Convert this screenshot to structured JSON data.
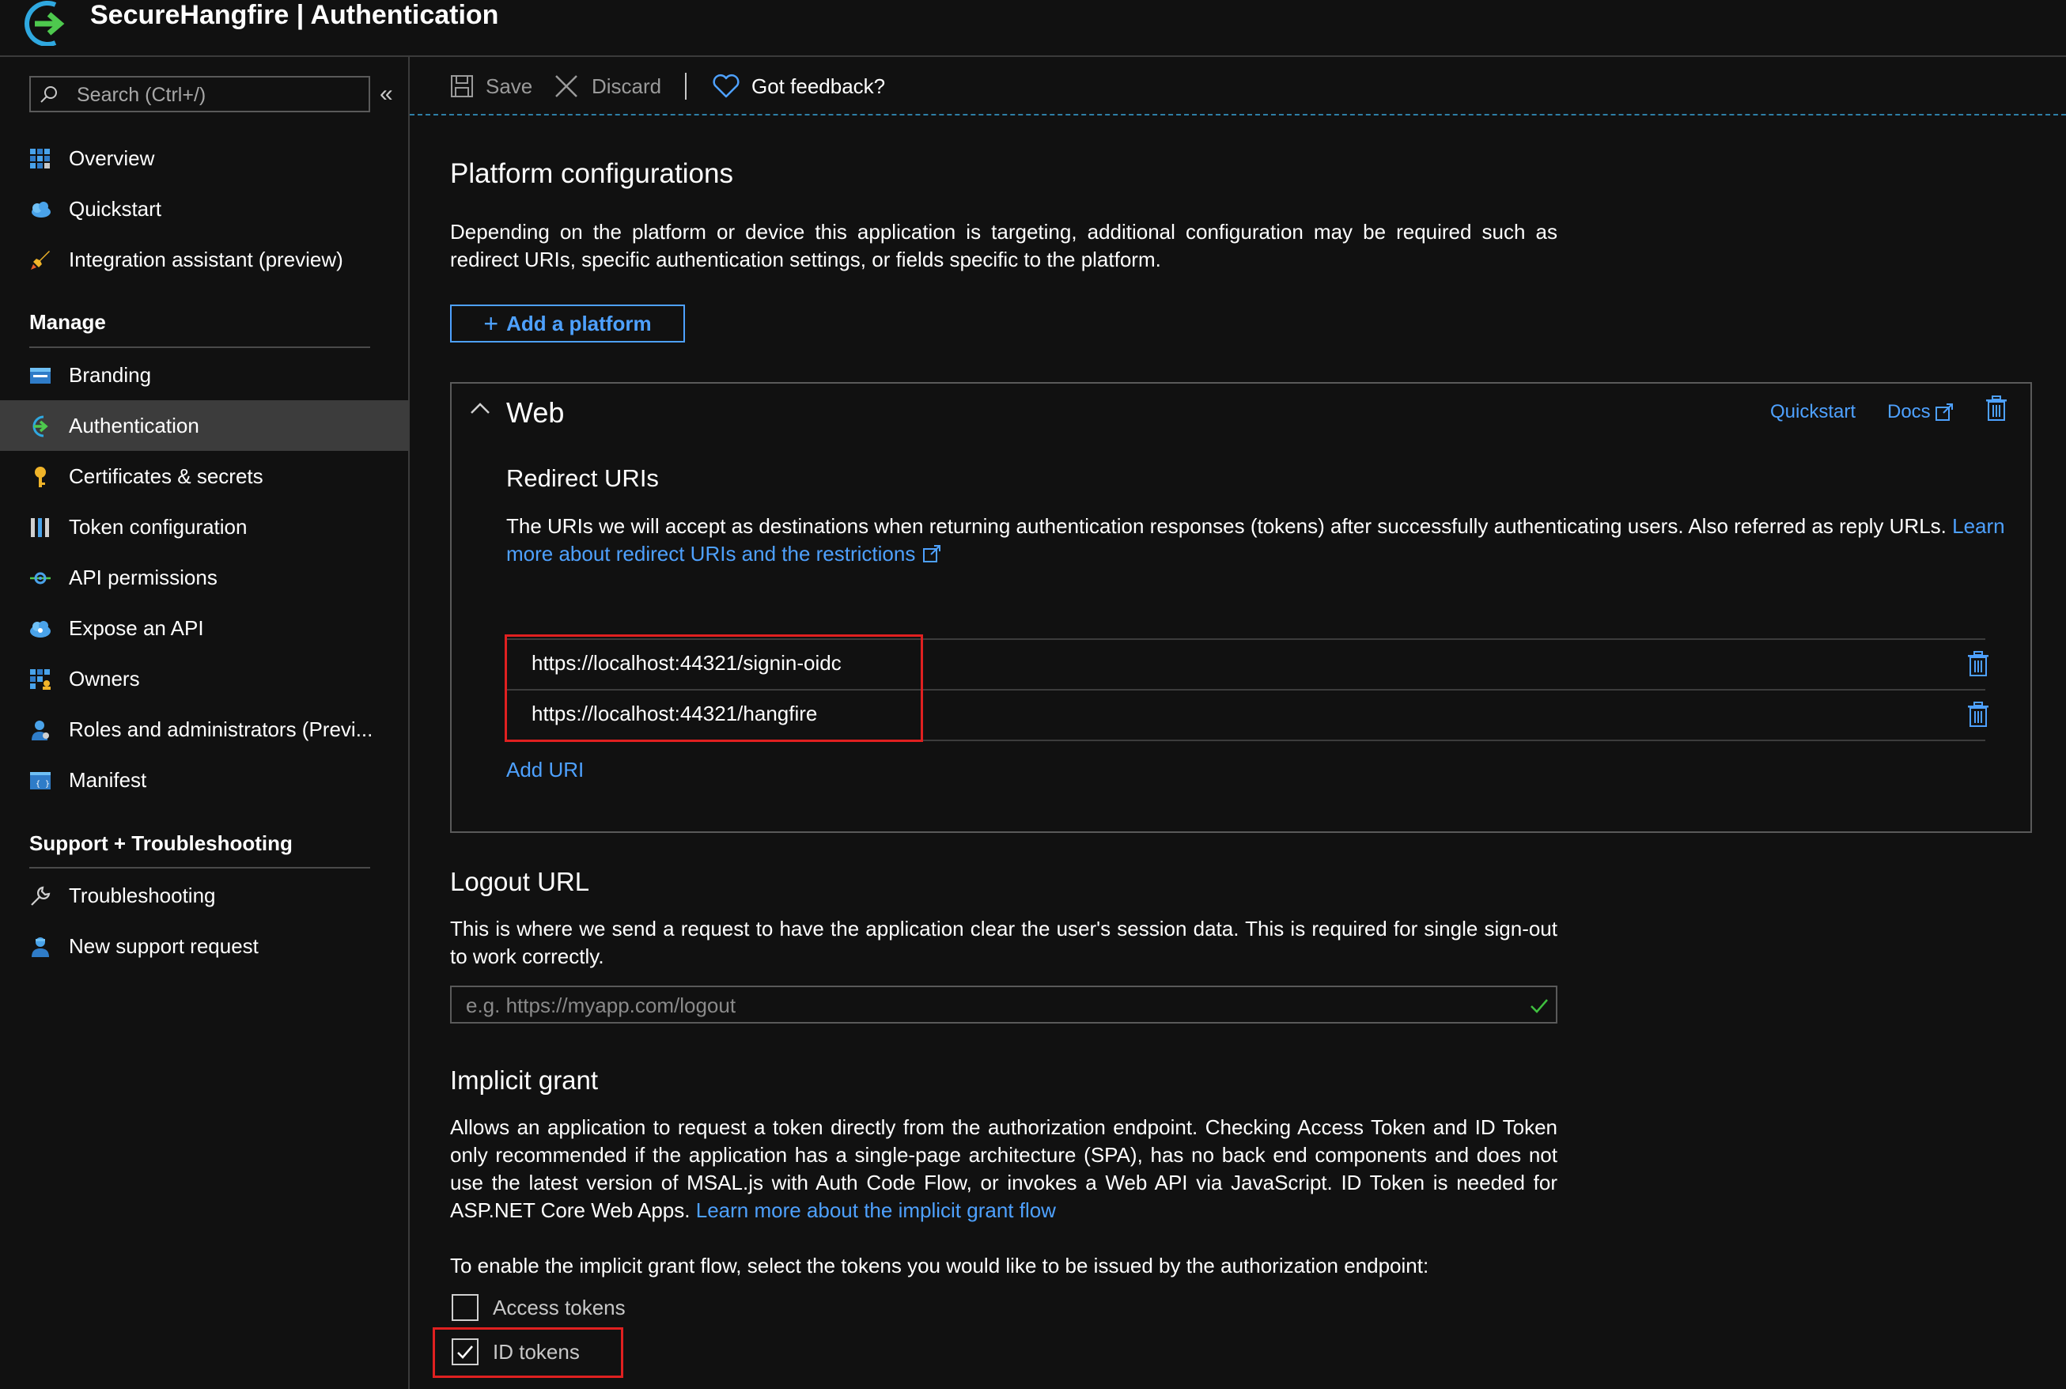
{
  "header": {
    "title": "SecureHangfire | Authentication"
  },
  "sidebar": {
    "search_placeholder": "Search (Ctrl+/)",
    "collapse_glyph": "«",
    "top_items": [
      {
        "label": "Overview",
        "icon": "overview-grid-icon"
      },
      {
        "label": "Quickstart",
        "icon": "quickstart-cloud-icon"
      },
      {
        "label": "Integration assistant (preview)",
        "icon": "rocket-icon"
      }
    ],
    "manage_heading": "Manage",
    "manage_items": [
      {
        "label": "Branding",
        "icon": "branding-icon"
      },
      {
        "label": "Authentication",
        "icon": "authentication-icon",
        "active": true
      },
      {
        "label": "Certificates & secrets",
        "icon": "key-icon"
      },
      {
        "label": "Token configuration",
        "icon": "token-bars-icon"
      },
      {
        "label": "API permissions",
        "icon": "api-permissions-icon"
      },
      {
        "label": "Expose an API",
        "icon": "cloud-api-icon"
      },
      {
        "label": "Owners",
        "icon": "owners-grid-icon"
      },
      {
        "label": "Roles and administrators (Previ...",
        "icon": "user-admin-icon"
      },
      {
        "label": "Manifest",
        "icon": "manifest-icon"
      }
    ],
    "support_heading": "Support + Troubleshooting",
    "support_items": [
      {
        "label": "Troubleshooting",
        "icon": "wrench-icon"
      },
      {
        "label": "New support request",
        "icon": "support-person-icon"
      }
    ]
  },
  "toolbar": {
    "save_label": "Save",
    "discard_label": "Discard",
    "feedback_label": "Got feedback?"
  },
  "platform": {
    "title": "Platform configurations",
    "description": "Depending on the platform or device this application is targeting, additional configuration may be required such as redirect URIs, specific authentication settings, or fields specific to the platform.",
    "add_button_plus": "+",
    "add_button_label": "Add a platform"
  },
  "web": {
    "title": "Web",
    "quickstart_link": "Quickstart",
    "docs_link": "Docs",
    "redirect_title": "Redirect URIs",
    "redirect_desc": "The URIs we will accept as destinations when returning authentication responses (tokens) after successfully authenticating users. Also referred as reply URLs.",
    "redirect_link": "Learn more about redirect URIs and the restrictions",
    "uris": [
      "https://localhost:44321/signin-oidc",
      "https://localhost:44321/hangfire"
    ],
    "add_uri": "Add URI"
  },
  "logout": {
    "title": "Logout URL",
    "description": "This is where we send a request to have the application clear the user's session data. This is required for single sign-out to work correctly.",
    "placeholder": "e.g. https://myapp.com/logout"
  },
  "implicit": {
    "title": "Implicit grant",
    "description": "Allows an application to request a token directly from the authorization endpoint. Checking Access Token and ID Token only recommended if the application has a single-page architecture (SPA), has no back end components and does not use the latest version of MSAL.js with Auth Code Flow, or invokes a Web API via JavaScript. ID Token is needed for ASP.NET Core Web Apps.",
    "link": "Learn more about the implicit grant flow",
    "instruction": "To enable the implicit grant flow, select the tokens you would like to be issued by the authorization endpoint:",
    "access_tokens_label": "Access tokens",
    "access_tokens_checked": false,
    "id_tokens_label": "ID tokens",
    "id_tokens_checked": true
  },
  "colors": {
    "background": "#111111",
    "link": "#4ea1ff",
    "active_nav": "#3c3c3c",
    "highlight_border": "#e02020",
    "success_check": "#3fbf3f"
  }
}
